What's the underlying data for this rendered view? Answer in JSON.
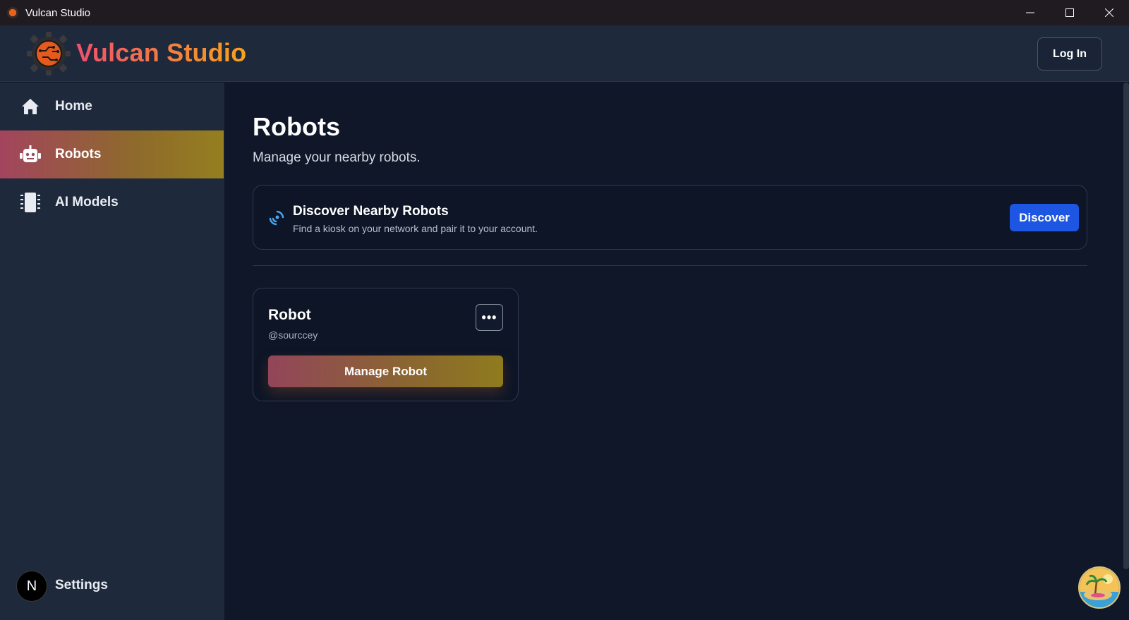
{
  "window": {
    "title": "Vulcan Studio"
  },
  "header": {
    "brand": "Vulcan Studio",
    "login_label": "Log In"
  },
  "sidebar": {
    "items": [
      {
        "label": "Home",
        "icon": "home-icon"
      },
      {
        "label": "Robots",
        "icon": "robot-icon",
        "active": true
      },
      {
        "label": "AI Models",
        "icon": "chip-icon"
      }
    ],
    "settings": {
      "label": "Settings",
      "avatar_letter": "N"
    }
  },
  "main": {
    "title": "Robots",
    "subtitle": "Manage your nearby robots.",
    "discover": {
      "title": "Discover Nearby Robots",
      "subtitle": "Find a kiosk on your network and pair it to your account.",
      "button": "Discover",
      "icon": "radar-icon"
    },
    "robots": [
      {
        "name": "Robot",
        "handle": "@sourccey",
        "manage_label": "Manage Robot",
        "more_label": "•••"
      }
    ]
  },
  "colors": {
    "accent_blue": "#1d56e2",
    "brand_gradient_start": "#f0506e",
    "brand_gradient_end": "#f7a31a",
    "sidebar_bg": "#1e293b",
    "main_bg": "#0f1729"
  }
}
